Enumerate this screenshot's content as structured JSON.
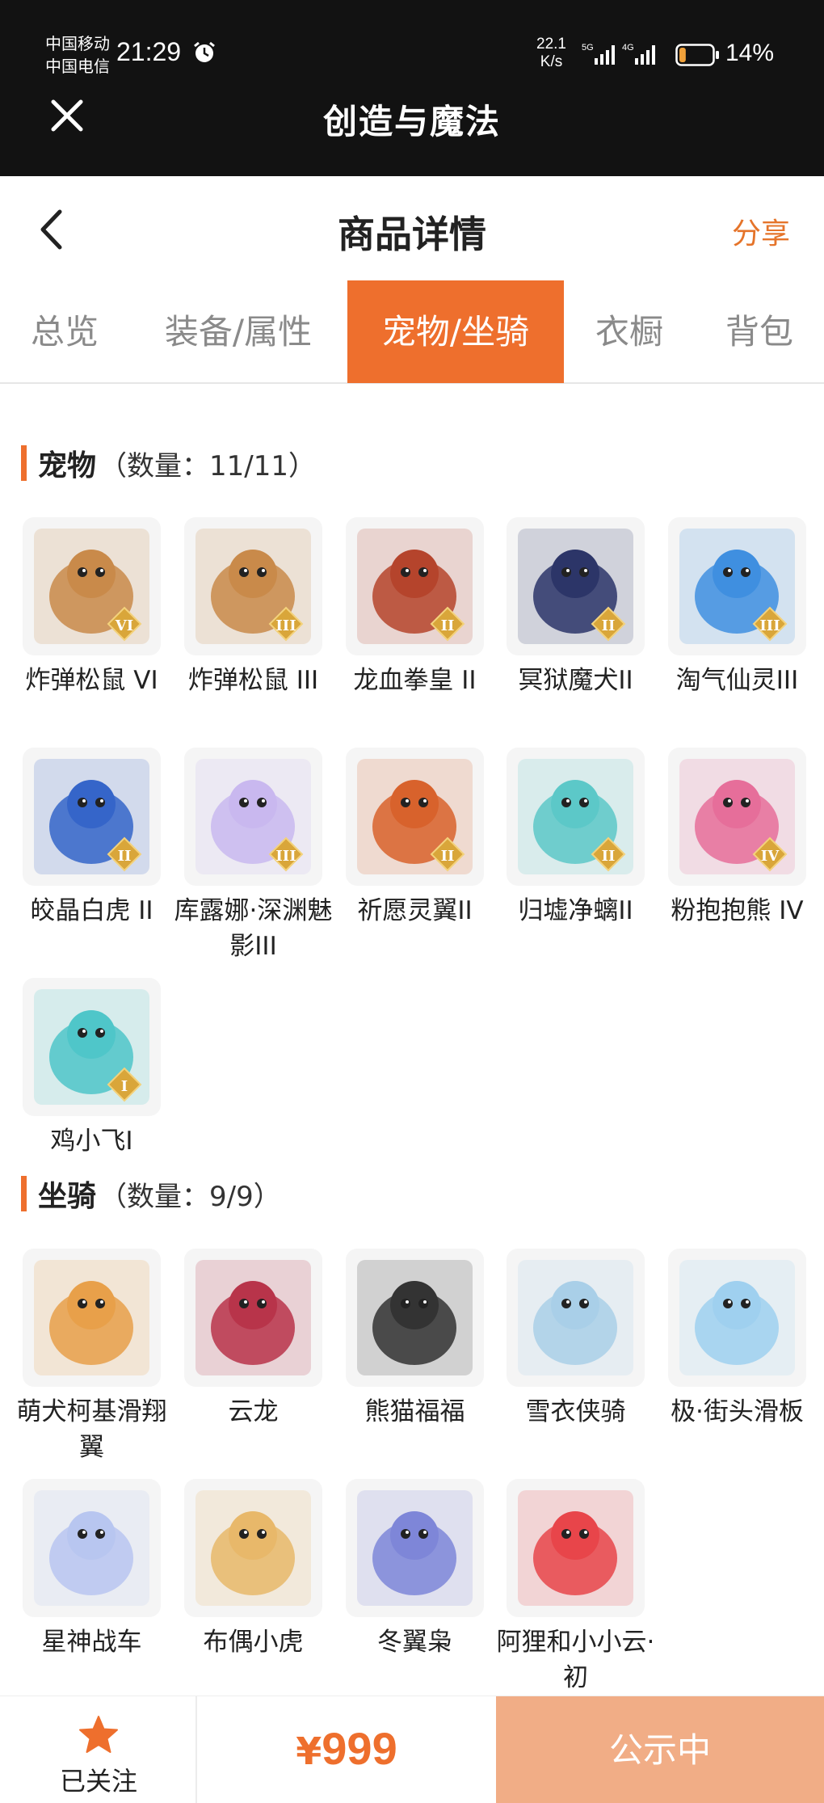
{
  "status_bar": {
    "carrier1": "中国移动",
    "carrier2": "中国电信",
    "time": "21:29",
    "net_speed_value": "22.1",
    "net_speed_unit": "K/s",
    "signal1_label": "5G",
    "signal2_label": "4G",
    "battery": "14%",
    "battery_level": 0.14
  },
  "app": {
    "title": "创造与魔法"
  },
  "header": {
    "title": "商品详情",
    "share": "分享"
  },
  "tabs": [
    {
      "label": "总览",
      "active": false
    },
    {
      "label": "装备/属性",
      "active": false
    },
    {
      "label": "宠物/坐骑",
      "active": true
    },
    {
      "label": "衣橱",
      "active": false
    },
    {
      "label": "背包",
      "active": false
    }
  ],
  "pets": {
    "title": "宠物",
    "count": "（数量：11/11）",
    "items": [
      {
        "name": "炸弹松鼠 VI",
        "icon": "squirrel-icon",
        "grade": "VI",
        "color": "#c98a4a"
      },
      {
        "name": "炸弹松鼠 III",
        "icon": "squirrel-icon",
        "grade": "III",
        "color": "#c98a4a"
      },
      {
        "name": "龙血拳皇 II",
        "icon": "dragon-fist-icon",
        "grade": "II",
        "color": "#b5442c"
      },
      {
        "name": "冥狱魔犬II",
        "icon": "hellhound-icon",
        "grade": "II",
        "color": "#2c3568"
      },
      {
        "name": "淘气仙灵III",
        "icon": "blue-pup-icon",
        "grade": "III",
        "color": "#3f8fe0"
      },
      {
        "name": "皎晶白虎 II",
        "icon": "white-tiger-icon",
        "grade": "II",
        "color": "#3565c9"
      },
      {
        "name": "库露娜·深渊魅影III",
        "icon": "fairy-girl-icon",
        "grade": "III",
        "color": "#c9b8ef"
      },
      {
        "name": "祈愿灵翼II",
        "icon": "phoenix-icon",
        "grade": "II",
        "color": "#d8622c"
      },
      {
        "name": "归墟净螭II",
        "icon": "water-dragon-icon",
        "grade": "II",
        "color": "#5cc8c8"
      },
      {
        "name": "粉抱抱熊 IV",
        "icon": "pink-bear-icon",
        "grade": "IV",
        "color": "#e66e9a"
      },
      {
        "name": "鸡小飞I",
        "icon": "chick-icon",
        "grade": "I",
        "color": "#4fc6c9"
      }
    ]
  },
  "mounts": {
    "title": "坐骑",
    "count": "（数量：9/9）",
    "items": [
      {
        "name": "萌犬柯基滑翔翼",
        "icon": "corgi-glider-icon",
        "color": "#e8a04a"
      },
      {
        "name": "云龙",
        "icon": "cloud-dragon-icon",
        "color": "#b8344a"
      },
      {
        "name": "熊猫福福",
        "icon": "panda-icon",
        "color": "#333333"
      },
      {
        "name": "雪衣侠骑",
        "icon": "white-horse-icon",
        "color": "#a9cfe8"
      },
      {
        "name": "极·街头滑板",
        "icon": "skateboard-icon",
        "color": "#9fd0ef"
      },
      {
        "name": "星神战车",
        "icon": "star-chariot-icon",
        "color": "#b8c6f0"
      },
      {
        "name": "布偶小虎",
        "icon": "plush-tiger-icon",
        "color": "#e8b86a"
      },
      {
        "name": "冬翼枭",
        "icon": "winter-owl-icon",
        "color": "#7e86d8"
      },
      {
        "name": "阿狸和小小云·初",
        "icon": "ali-fox-icon",
        "color": "#e8454a"
      }
    ]
  },
  "bottom": {
    "follow_label": "已关注",
    "currency": "¥",
    "price": "999",
    "status": "公示中"
  },
  "colors": {
    "accent": "#ee6f2d",
    "button_light": "#f1ad86",
    "topbar": "#121212"
  }
}
